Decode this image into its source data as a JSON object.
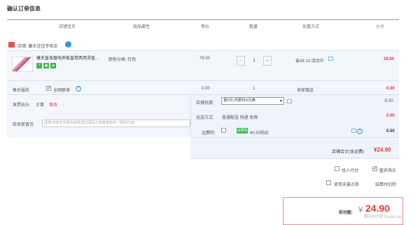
{
  "page": {
    "title": "确认订单信息"
  },
  "columns": [
    "店铺宝贝",
    "商品属性",
    "单价",
    "数量",
    "优惠方式",
    "小计"
  ],
  "shop": {
    "label": "店铺: 康夫佳佳专卖店"
  },
  "item": {
    "name": "康夫直发器电夹板直卷两用烫直...",
    "attr": "颜色分类: 红色",
    "price": "78.00",
    "qty": "1",
    "promo": "省48.10:活动中",
    "subtotal": "29.90",
    "badges": [
      "7",
      "▣",
      "◈"
    ],
    "colors": {
      "badge1": "#3db554",
      "badge2": "#3db554",
      "badge3": "#3db554"
    }
  },
  "service": {
    "label": "售后服务",
    "option": "全国联保",
    "price": "0.00",
    "qty": "1",
    "promo": "卖家赠送",
    "subtotal": "0.00"
  },
  "invoice": {
    "label": "发票抬头:",
    "name": "王菁",
    "edit": "修改"
  },
  "message": {
    "label": "给卖家留言:",
    "placeholder": "选填:对本次交易的说明(建议填写已和卖家协商一致的内容)"
  },
  "shop_discount": {
    "label": "店铺优惠:",
    "value": "省5元:内部价5元券",
    "amount": "-5.00"
  },
  "shipping": {
    "label": "运送方式:",
    "value": "普通配送 快递 免邮",
    "amount": "0.00"
  },
  "insurance": {
    "label": "运费险:",
    "tag": "运费险",
    "value": "¥0.50购买",
    "amount": "0.50"
  },
  "shop_total": {
    "label": "店铺合计(含运费)",
    "amount": "¥24.90"
  },
  "options": {
    "friend_pay": "找人代付",
    "anonymous": "匿名购买",
    "points": "使用天猫点券",
    "cod": "结算时扣除"
  },
  "payment": {
    "label": "实付款:",
    "yen": "¥",
    "amount": "24.90"
  },
  "watermark": "第9软件网 9sale.com"
}
